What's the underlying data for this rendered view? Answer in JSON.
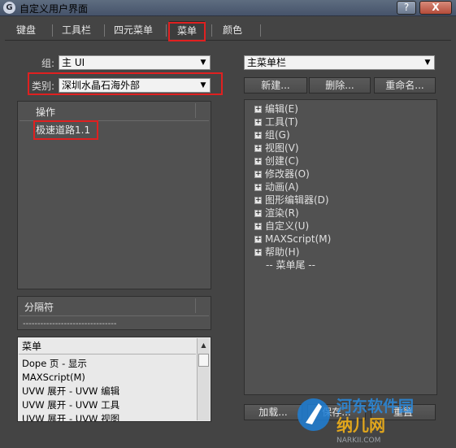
{
  "window": {
    "title": "自定义用户界面",
    "icon_glyph": "G",
    "help_label": "?",
    "close_label": "X"
  },
  "tabs": [
    "键盘",
    "工具栏",
    "四元菜单",
    "菜单",
    "颜色"
  ],
  "active_tab": "菜单",
  "left": {
    "group_label": "组:",
    "group_value": "主 UI",
    "category_label": "类别:",
    "category_value": "深圳水晶石海外部",
    "actions_header": "操作",
    "actions_items": [
      "极速道路1.1"
    ],
    "separator_header": "分隔符",
    "separator_item": "--------------------------------",
    "menus_header": "菜单",
    "menus_items": [
      "Dope 页 - 显示",
      "MAXScript(M)",
      "UVW 展开 - UVW 编辑",
      "UVW 展开 - UVW 工具",
      "UVW 展开 - UVW 视图"
    ]
  },
  "right": {
    "menu_bar_value": "主菜单栏",
    "new_button": "新建...",
    "delete_button": "删除...",
    "rename_button": "重命名...",
    "tree_items": [
      "编辑(E)",
      "工具(T)",
      "组(G)",
      "视图(V)",
      "创建(C)",
      "修改器(O)",
      "动画(A)",
      "图形编辑器(D)",
      "渲染(R)",
      "自定义(U)",
      "MAXScript(M)",
      "帮助(H)"
    ],
    "tree_end": "-- 菜单尾 --",
    "load_button": "加载...",
    "save_button": "保存...",
    "reset_button": "重置"
  },
  "watermark": {
    "line1": "河东软件园",
    "line2": "纳儿网",
    "line3": "NARKII.COM"
  },
  "colors": {
    "highlight": "#e02020",
    "background": "#444444"
  }
}
